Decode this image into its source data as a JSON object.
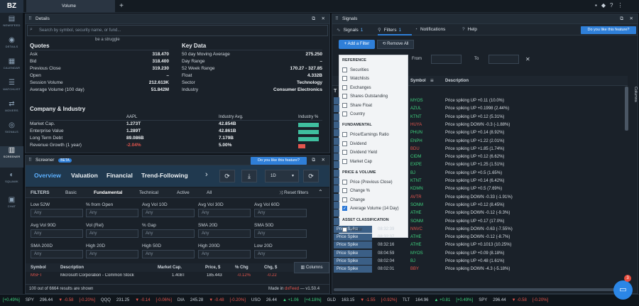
{
  "app": {
    "logo": "BZ",
    "tab": "Volume",
    "tab_plus": "+"
  },
  "rail": [
    {
      "label": "NEWSFEED",
      "icon": "newspaper-icon",
      "glyph": "▤"
    },
    {
      "label": "DETAILS",
      "icon": "details-icon",
      "glyph": "◉"
    },
    {
      "label": "CALENDAR",
      "icon": "calendar-icon",
      "glyph": "▦"
    },
    {
      "label": "WATCHLIST",
      "icon": "watchlist-icon",
      "glyph": "☰"
    },
    {
      "label": "MOVERS",
      "icon": "movers-icon",
      "glyph": "⇄"
    },
    {
      "label": "SIGNALS",
      "icon": "signals-icon",
      "glyph": "◎"
    },
    {
      "label": "SCREENER",
      "icon": "screener-icon",
      "glyph": "▥"
    },
    {
      "label": "SQUAWK",
      "icon": "squawk-icon",
      "glyph": "◐"
    },
    {
      "label": "CHAT",
      "icon": "chat-icon",
      "glyph": "▣"
    }
  ],
  "details": {
    "title": "Details",
    "search_placeholder": "Search by symbol, security name, or fund...",
    "cut_text": "be a struggle",
    "quotes_title": "Quotes",
    "quotes": [
      {
        "label": "Ask",
        "value": "318.470"
      },
      {
        "label": "Bid",
        "value": "318.400"
      },
      {
        "label": "Previous Close",
        "value": "319.230"
      },
      {
        "label": "Open",
        "value": "–"
      },
      {
        "label": "Session Volume",
        "value": "212.613K"
      },
      {
        "label": "Average Volume (100 day)",
        "value": "51.842M"
      }
    ],
    "keydata_title": "Key Data",
    "keydata": [
      {
        "label": "50 day Moving Average",
        "value": "275.250"
      },
      {
        "label": "Day Range",
        "value": "–"
      },
      {
        "label": "52 Week Range",
        "value": "170.27 - 327.85"
      },
      {
        "label": "Float",
        "value": "4.332B"
      },
      {
        "label": "Sector",
        "value": "Technology"
      },
      {
        "label": "Industry",
        "value": "Consumer Electronics"
      }
    ],
    "company_title": "Company & Industry",
    "col_aapl": "AAPL",
    "col_industry_avg": "Industry Avg.",
    "col_industry_pct": "Industry %",
    "company_rows": [
      {
        "label": "Market Cap.",
        "aapl": "1.273T",
        "avg": "42.854B",
        "pct": 0.9,
        "color": "#3fbf9f"
      },
      {
        "label": "Enterprise Value",
        "aapl": "1.289T",
        "avg": "42.861B",
        "pct": 0.9,
        "color": "#3fbf9f"
      },
      {
        "label": "Long Term Debt",
        "aapl": "89.086B",
        "avg": "7.179B",
        "pct": 0.9,
        "color": "#3fbf9f"
      },
      {
        "label": "Revenue Growth (1 year)",
        "aapl": "-2.04%",
        "avg": "5.00%",
        "pct": 0.3,
        "color": "#e5554d"
      }
    ]
  },
  "screener": {
    "title": "Screener",
    "beta": "BETA",
    "feature_btn": "Do you like this feature?",
    "tabs": [
      "Overview",
      "Valuation",
      "Financial",
      "Trend-Following"
    ],
    "interval": "1D",
    "filters_label": "FILTERS",
    "filter_tabs": [
      "Basic",
      "Fundamental",
      "Technical",
      "Active",
      "All"
    ],
    "reset": "Reset filters",
    "fields": [
      [
        "Low 52W",
        "% from Open",
        "Avg Vol 10D",
        "Avg Vol 30D",
        "Avg Vol 60D"
      ],
      [
        "Avg Vol 90D",
        "Vol (Rel)",
        "% Gap",
        "SMA 20D",
        "SMA 50D"
      ],
      [
        "SMA 200D",
        "High 20D",
        "High 50D",
        "High 200D",
        "Low 20D"
      ]
    ],
    "any": "Any",
    "table_headers": [
      "Symbol",
      "Description",
      "Market Cap.",
      "Price, $",
      "% Chg",
      "Chg, $"
    ],
    "columns_btn": "Columns",
    "row_symbol": "MSFT",
    "row_desc": "Microsoft Corporation - Common Stock",
    "row_cap": "1.408T",
    "row_price": "185.443",
    "row_chg_pct": "-0.12%",
    "row_chg": "-0.22",
    "footer_left": "100 out of 6664 results are shown",
    "footer_made": "Made in",
    "footer_brand": "dxFeed",
    "footer_version": "— v1.50.4"
  },
  "signals": {
    "title": "Signals",
    "tabs": [
      {
        "label": "Signals",
        "count": "1"
      },
      {
        "label": "Filters",
        "count": "1"
      },
      {
        "label": "Notifications",
        "count": ""
      },
      {
        "label": "Help",
        "count": ""
      }
    ],
    "feature_btn": "Do you like this feature?",
    "add_filter": "+ Add a Filter",
    "remove_all": "Remove All",
    "from": "From",
    "to": "To",
    "col_symbol": "Symbol",
    "col_desc": "Description",
    "columns_label": "Columns",
    "rows": [
      {
        "sym": "MYOS",
        "desc": "Price spiking UP +0.11 (10.0%)",
        "up": true
      },
      {
        "sym": "AZUL",
        "desc": "Price spiking UP +0.1998 (2.44%)",
        "up": true
      },
      {
        "sym": "KTNT",
        "desc": "Price spiking UP +0.12 (5.31%)",
        "up": true
      },
      {
        "sym": "HUYA",
        "desc": "Price spiking DOWN -0.3 (-1.88%)",
        "up": false
      },
      {
        "sym": "PHUN",
        "desc": "Price spiking UP +0.14 (8.92%)",
        "up": true
      },
      {
        "sym": "ENPH",
        "desc": "Price spiking UP +1.22 (2.01%)",
        "up": true
      },
      {
        "sym": "BDU",
        "desc": "Price spiking UP +1.85 (1.74%)",
        "up": false
      },
      {
        "sym": "CIDM",
        "desc": "Price spiking UP +0.12 (6.62%)",
        "up": true
      },
      {
        "sym": "EXPE",
        "desc": "Price spiking UP +1.25 (1.51%)",
        "up": true
      },
      {
        "sym": "BJ",
        "desc": "Price spiking UP +0.5 (1.65%)",
        "up": true
      },
      {
        "sym": "KTNT",
        "desc": "Price spiking UP +0.14 (6.42%)",
        "up": true
      },
      {
        "sym": "KDMN",
        "desc": "Price spiking UP +0.5 (7.69%)",
        "up": true
      },
      {
        "sym": "AVTR",
        "desc": "Price spiking DOWN -0.33 (-1.91%)",
        "up": false
      },
      {
        "sym": "SONM",
        "desc": "Price spiking UP +0.12 (8.45%)",
        "up": true
      },
      {
        "sym": "ATHE",
        "desc": "Price spiking DOWN -0.12 (-9.3%)",
        "up": true
      },
      {
        "sym": "SONM",
        "desc": "Price spiking UP +0.17 (17.0%)",
        "up": true
      },
      {
        "sym": "NNVC",
        "desc": "Price spiking DOWN -0.63 (-7.55%)",
        "up": false,
        "badge": "Price Spike",
        "time": "08:32:39"
      },
      {
        "sym": "ATHE",
        "desc": "Price spiking DOWN -0.12 (-8.7%)",
        "up": true,
        "badge": "Price Spike",
        "time": "08:32:37"
      },
      {
        "sym": "ATHE",
        "desc": "Price spiking UP +0.1013 (10.25%)",
        "up": true,
        "badge": "Price Spike",
        "time": "08:32:16"
      },
      {
        "sym": "MYOS",
        "desc": "Price spiking UP +0.09 (8.18%)",
        "up": true,
        "badge": "Price Spike",
        "time": "08:04:59"
      },
      {
        "sym": "BJ",
        "desc": "Price spiking UP +0.48 (1.61%)",
        "up": true,
        "badge": "Price Spike",
        "time": "08:02:04"
      },
      {
        "sym": "BBY",
        "desc": "Price spiking DOWN -4.3 (-5.18%)",
        "up": false,
        "badge": "Price Spike",
        "time": "08:02:01"
      }
    ],
    "dropdown": {
      "sections": [
        {
          "title": "REFERENCE",
          "items": [
            {
              "label": "Securities",
              "on": false
            },
            {
              "label": "Watchlists",
              "on": false
            },
            {
              "label": "Exchanges",
              "on": false
            },
            {
              "label": "Shares Outstanding",
              "on": false
            },
            {
              "label": "Share Float",
              "on": false
            },
            {
              "label": "Country",
              "on": false
            }
          ]
        },
        {
          "title": "FUNDAMENTAL",
          "items": [
            {
              "label": "Price/Earnings Ratio",
              "on": false
            },
            {
              "label": "Dividend",
              "on": false
            },
            {
              "label": "Dividend Yield",
              "on": false
            },
            {
              "label": "Market Cap",
              "on": false
            }
          ]
        },
        {
          "title": "PRICE & VOLUME",
          "items": [
            {
              "label": "Price (Previous Close)",
              "on": false
            },
            {
              "label": "Change %",
              "on": false
            },
            {
              "label": "Change",
              "on": false
            },
            {
              "label": "Average Volume (14 Day)",
              "on": true
            }
          ]
        },
        {
          "title": "ASSET CLASSIFICATION",
          "items": [
            {
              "label": "Sector",
              "on": false
            }
          ]
        }
      ]
    }
  },
  "ticker": [
    {
      "text": "[+0.49%]",
      "color": "#3fd37f"
    },
    {
      "text": "SPY",
      "color": "#c9d1d9"
    },
    {
      "text": "296.44",
      "color": "#c9d1d9"
    },
    {
      "text": "▼ -0.58",
      "color": "#e5554d"
    },
    {
      "text": "[-0.20%]",
      "color": "#e5554d"
    },
    {
      "text": "QQQ",
      "color": "#c9d1d9"
    },
    {
      "text": "231.25",
      "color": "#c9d1d9"
    },
    {
      "text": "▼ -0.14",
      "color": "#e5554d"
    },
    {
      "text": "[-0.06%]",
      "color": "#e5554d"
    },
    {
      "text": "DIA",
      "color": "#c9d1d9"
    },
    {
      "text": "245.28",
      "color": "#c9d1d9"
    },
    {
      "text": "▼ -0.48",
      "color": "#e5554d"
    },
    {
      "text": "[-0.20%]",
      "color": "#e5554d"
    },
    {
      "text": "USO",
      "color": "#c9d1d9"
    },
    {
      "text": "26.44",
      "color": "#c9d1d9"
    },
    {
      "text": "▲ +1.06",
      "color": "#3fd37f"
    },
    {
      "text": "[+4.18%]",
      "color": "#3fd37f"
    },
    {
      "text": "GLD",
      "color": "#c9d1d9"
    },
    {
      "text": "163.15",
      "color": "#c9d1d9"
    },
    {
      "text": "▼ -1.55",
      "color": "#e5554d"
    },
    {
      "text": "[-0.92%]",
      "color": "#e5554d"
    },
    {
      "text": "TLT",
      "color": "#c9d1d9"
    },
    {
      "text": "164.96",
      "color": "#c9d1d9"
    },
    {
      "text": "▲ +0.81",
      "color": "#3fd37f"
    },
    {
      "text": "[+0.49%]",
      "color": "#3fd37f"
    },
    {
      "text": "SPY",
      "color": "#c9d1d9"
    },
    {
      "text": "296.44",
      "color": "#c9d1d9"
    },
    {
      "text": "▼ -0.58",
      "color": "#e5554d"
    },
    {
      "text": "[-0.20%]",
      "color": "#e5554d"
    }
  ],
  "chat_badge": "3"
}
